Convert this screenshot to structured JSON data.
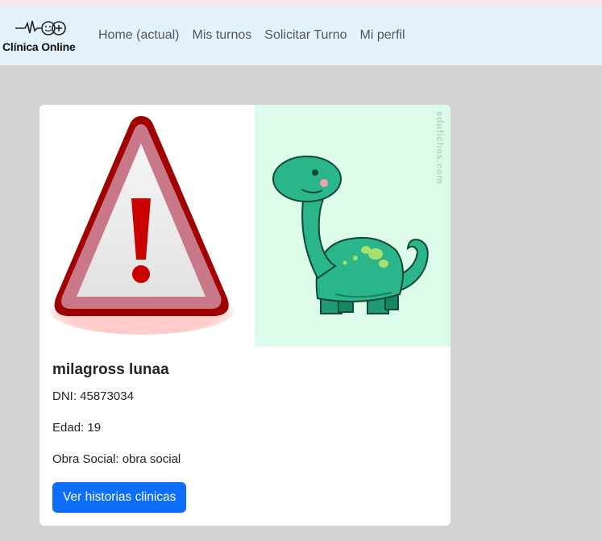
{
  "navbar": {
    "brand_text": "Clínica Online",
    "links": [
      {
        "label": "Home (actual)"
      },
      {
        "label": "Mis turnos"
      },
      {
        "label": "Solicitar Turno"
      },
      {
        "label": "Mi perfil"
      }
    ]
  },
  "card": {
    "images": {
      "left_icon": "warning-icon",
      "right_image": "dinosaur-image",
      "watermark": "edufichas.com"
    },
    "name": "milagross lunaa",
    "dni": "DNI: 45873034",
    "edad": "Edad: 19",
    "obra_social": "Obra Social: obra social",
    "button_label": "Ver historias clinicas"
  },
  "colors": {
    "navbar_bg": "#e3f2fd",
    "page_bg": "#d3d3d3",
    "primary": "#0d6efd"
  }
}
